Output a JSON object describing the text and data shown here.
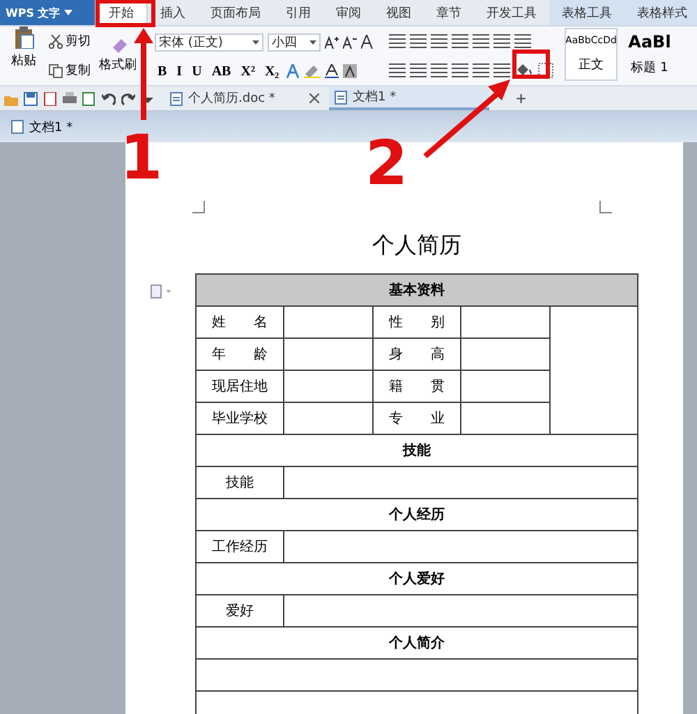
{
  "app": {
    "name": "WPS 文字"
  },
  "menu_tabs": [
    {
      "label": "开始",
      "selected": true,
      "kind": "main"
    },
    {
      "label": "插入",
      "selected": false,
      "kind": "main"
    },
    {
      "label": "页面布局",
      "selected": false,
      "kind": "main"
    },
    {
      "label": "引用",
      "selected": false,
      "kind": "main"
    },
    {
      "label": "审阅",
      "selected": false,
      "kind": "main"
    },
    {
      "label": "视图",
      "selected": false,
      "kind": "main"
    },
    {
      "label": "章节",
      "selected": false,
      "kind": "main"
    },
    {
      "label": "开发工具",
      "selected": false,
      "kind": "main"
    },
    {
      "label": "表格工具",
      "selected": false,
      "kind": "context"
    },
    {
      "label": "表格样式",
      "selected": false,
      "kind": "context"
    }
  ],
  "ribbon": {
    "paste": "粘贴",
    "cut": "剪切",
    "copy": "复制",
    "format_painter": "格式刷",
    "font_name": "宋体 (正文)",
    "font_size": "小四",
    "format_buttons": [
      "B",
      "I",
      "U",
      "AB",
      "X²",
      "X₂"
    ],
    "styles": [
      {
        "preview": "AaBbCcDd",
        "label": "正文"
      },
      {
        "preview": "AaBl",
        "label": "标题 1"
      }
    ]
  },
  "doc_tabs": [
    {
      "title": "个人简历.doc *",
      "selected": false
    },
    {
      "title": "文档1 *",
      "selected": true
    }
  ],
  "new_tab": "+",
  "doc_bar": {
    "title": "文档1 *"
  },
  "document": {
    "title": "个人简历",
    "rows": [
      {
        "kind": "header",
        "text": "基本资料"
      },
      {
        "kind": "pair",
        "label_1": "姓　　名",
        "label_2": "性　　别"
      },
      {
        "kind": "pair",
        "label_1": "年　　龄",
        "label_2": "身　　高"
      },
      {
        "kind": "pair",
        "label_1": "现居住地",
        "label_2": "籍　　贯"
      },
      {
        "kind": "pair",
        "label_1": "毕业学校",
        "label_2": "专　　业"
      },
      {
        "kind": "section",
        "text": "技能"
      },
      {
        "kind": "field",
        "label": "技能"
      },
      {
        "kind": "section",
        "text": "个人经历"
      },
      {
        "kind": "field",
        "label": "工作经历"
      },
      {
        "kind": "section",
        "text": "个人爱好"
      },
      {
        "kind": "field",
        "label": "爱好"
      },
      {
        "kind": "section",
        "text": "个人简介"
      },
      {
        "kind": "blank"
      },
      {
        "kind": "blank"
      }
    ]
  },
  "annotations": [
    {
      "number": "1"
    },
    {
      "number": "2"
    }
  ]
}
